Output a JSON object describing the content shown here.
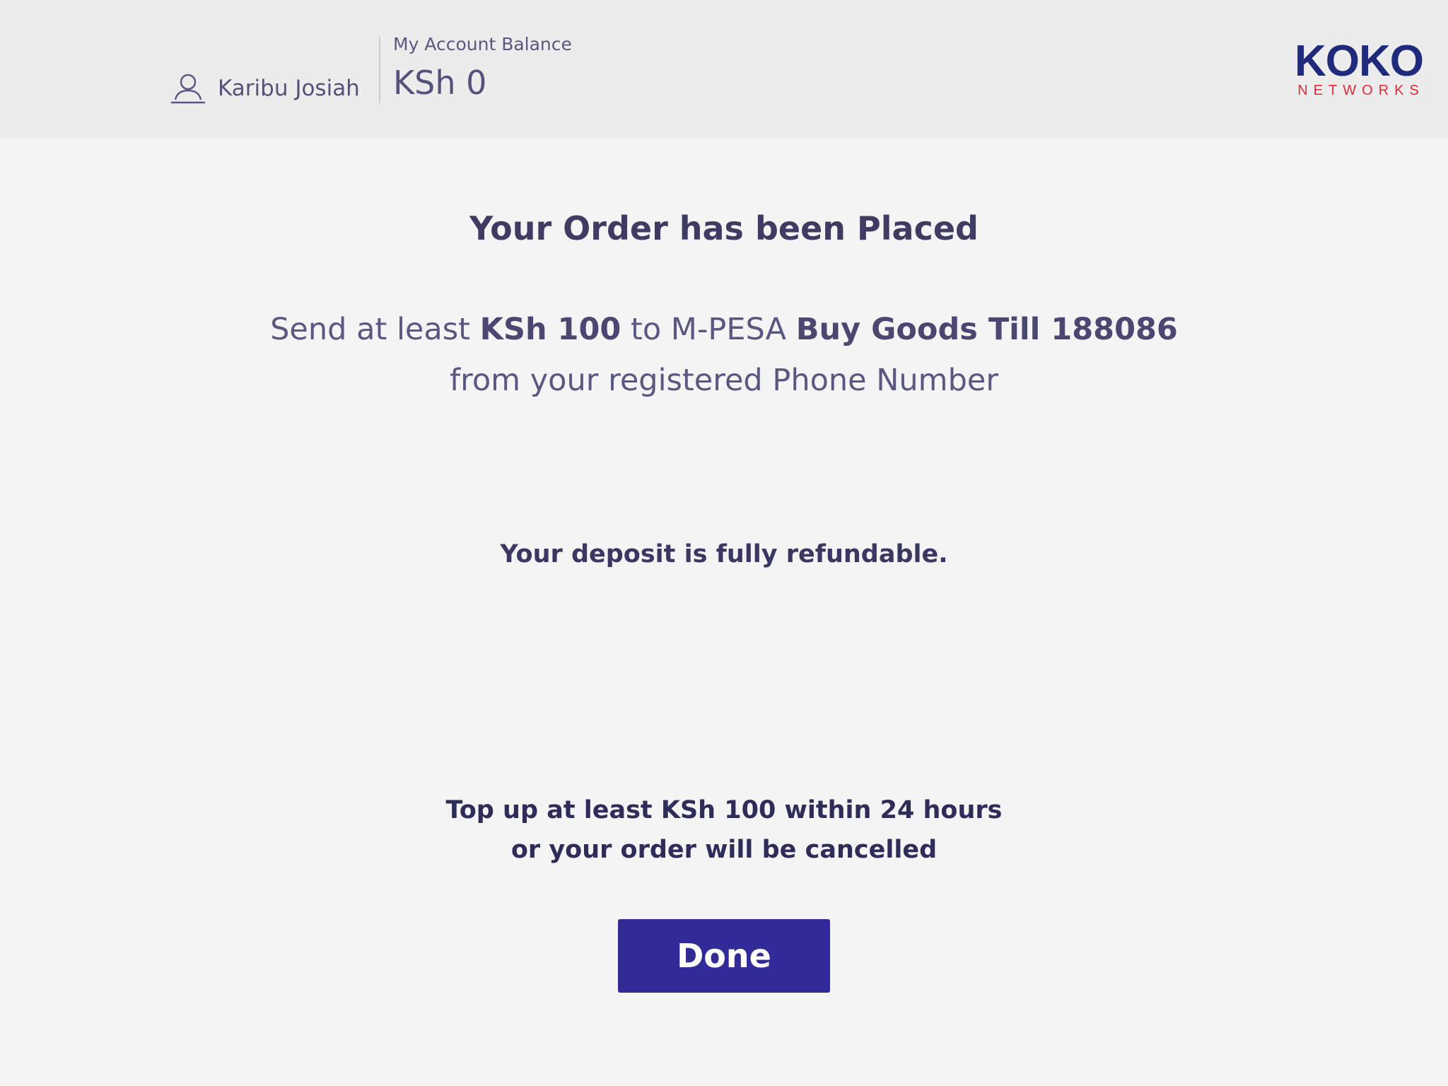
{
  "header": {
    "user_name": "Karibu Josiah",
    "balance_label": "My Account Balance",
    "balance_value": "KSh 0",
    "logo_main": "KOKO",
    "logo_sub": "NETWORKS",
    "logo_colors": {
      "main": "#1f2a7c",
      "sub": "#e02a3a"
    }
  },
  "main": {
    "title": "Your Order has been Placed",
    "instruction": {
      "part1": "Send at least ",
      "amount": "KSh 100",
      "part2": " to M-PESA ",
      "till": "Buy Goods Till 188086",
      "line2": "from your registered Phone Number"
    },
    "refund_note": "Your deposit is fully refundable.",
    "warning_line1": "Top up at least KSh 100 within 24 hours",
    "warning_line2": "or your order will be cancelled",
    "done_label": "Done"
  },
  "colors": {
    "background": "#f4f4f4",
    "header_background": "#ececec",
    "button": "#302b96",
    "text": "#4a4870"
  },
  "icons": {
    "user": "user-icon"
  }
}
